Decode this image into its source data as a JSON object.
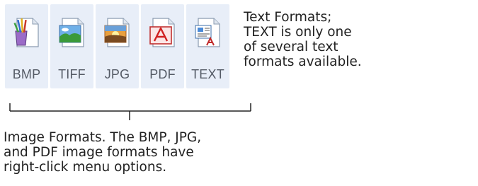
{
  "format_buttons": [
    {
      "id": "bmp",
      "label": "BMP",
      "icon": "bmp-paint-icon"
    },
    {
      "id": "tiff",
      "label": "TIFF",
      "icon": "tiff-landscape-icon"
    },
    {
      "id": "jpg",
      "label": "JPG",
      "icon": "jpg-sunset-icon"
    },
    {
      "id": "pdf",
      "label": "PDF",
      "icon": "pdf-acrobat-icon"
    },
    {
      "id": "text",
      "label": "TEXT",
      "icon": "text-document-icon"
    }
  ],
  "text_note": {
    "lines": [
      "Text Formats;",
      "TEXT is only one",
      "of several text",
      "formats available."
    ]
  },
  "image_note": {
    "lines": [
      "Image Formats. The BMP, JPG,",
      "and PDF image formats have",
      "right-click menu options."
    ]
  }
}
